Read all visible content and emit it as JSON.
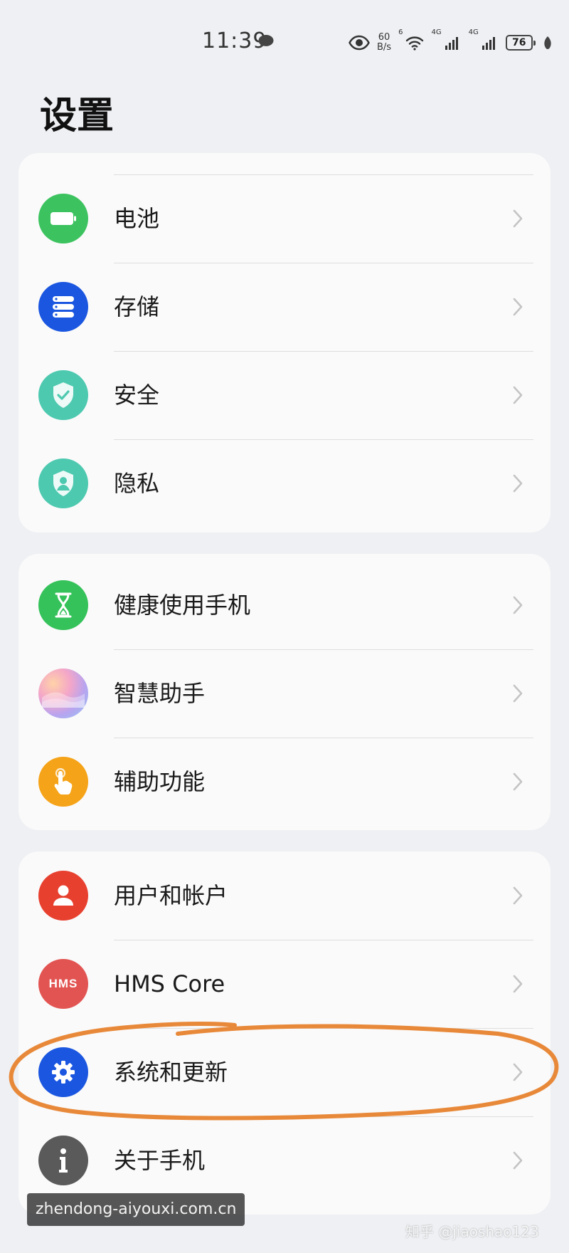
{
  "status_bar": {
    "time": "11:39",
    "net_speed_value": "60",
    "net_speed_unit": "B/s",
    "wifi_tag": "6",
    "signal1_tag": "4G",
    "signal2_tag": "4G",
    "battery": "76"
  },
  "page": {
    "title": "设置"
  },
  "groups": [
    {
      "items": [
        {
          "label": "电池",
          "icon": "battery-icon",
          "color": "#3cc35f"
        },
        {
          "label": "存储",
          "icon": "storage-icon",
          "color": "#1a56e0"
        },
        {
          "label": "安全",
          "icon": "security-shield-icon",
          "color": "#4dc9b0"
        },
        {
          "label": "隐私",
          "icon": "privacy-icon",
          "color": "#4dc9b0"
        }
      ]
    },
    {
      "items": [
        {
          "label": "健康使用手机",
          "icon": "hourglass-icon",
          "color": "#35c25a"
        },
        {
          "label": "智慧助手",
          "icon": "assistant-icon",
          "color": "#e6a2d0"
        },
        {
          "label": "辅助功能",
          "icon": "accessibility-hand-icon",
          "color": "#f5a318"
        }
      ]
    },
    {
      "items": [
        {
          "label": "用户和帐户",
          "icon": "user-icon",
          "color": "#e8402f"
        },
        {
          "label": "HMS Core",
          "icon": "hms-icon",
          "color": "#e25452"
        },
        {
          "label": "系统和更新",
          "icon": "gear-icon",
          "color": "#1a56e0"
        },
        {
          "label": "关于手机",
          "icon": "info-icon",
          "color": "#5a5a5a"
        }
      ]
    }
  ],
  "hms_icon_text": "HMS",
  "watermarks": {
    "site": "zhendong-aiyouxi.com.cn",
    "corner": "知乎 @jiaoshao123"
  },
  "colors": {
    "annotation": "#e8893a",
    "chevron": "#c4c4c4"
  }
}
